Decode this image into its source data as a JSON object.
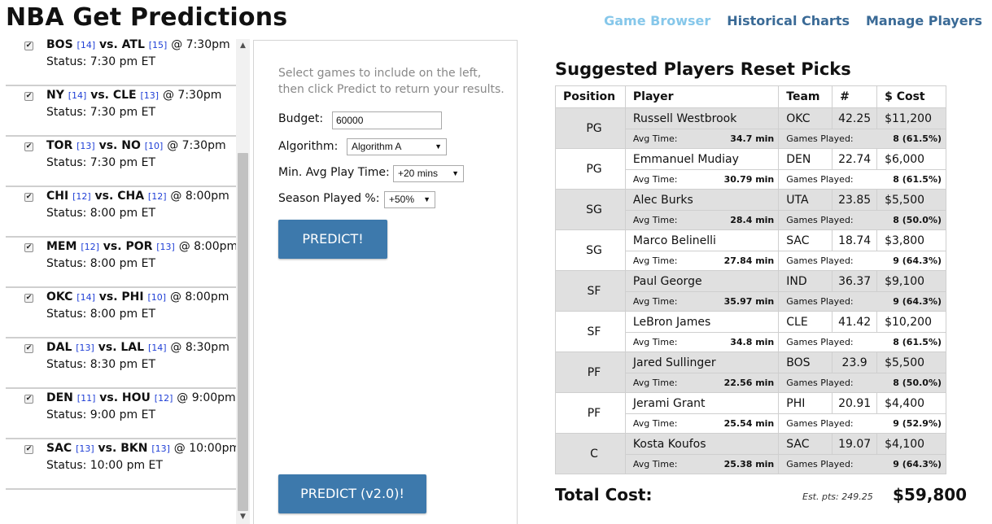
{
  "app": {
    "title": "NBA Get Predictions"
  },
  "nav": {
    "items": [
      "Game Browser",
      "Historical Charts",
      "Manage Players"
    ]
  },
  "games": [
    {
      "home": "BOS",
      "home_rank": "[14]",
      "vs": "vs.",
      "away": "ATL",
      "away_rank": "[15]",
      "time": "@ 7:30pm",
      "status": "Status: 7:30 pm ET",
      "checked": true
    },
    {
      "home": "NY",
      "home_rank": "[14]",
      "vs": "vs.",
      "away": "CLE",
      "away_rank": "[13]",
      "time": "@ 7:30pm",
      "status": "Status: 7:30 pm ET",
      "checked": true
    },
    {
      "home": "TOR",
      "home_rank": "[13]",
      "vs": "vs.",
      "away": "NO",
      "away_rank": "[10]",
      "time": "@ 7:30pm",
      "status": "Status: 7:30 pm ET",
      "checked": true
    },
    {
      "home": "CHI",
      "home_rank": "[12]",
      "vs": "vs.",
      "away": "CHA",
      "away_rank": "[12]",
      "time": "@ 8:00pm",
      "status": "Status: 8:00 pm ET",
      "checked": true
    },
    {
      "home": "MEM",
      "home_rank": "[12]",
      "vs": "vs.",
      "away": "POR",
      "away_rank": "[13]",
      "time": "@ 8:00pm",
      "status": "Status: 8:00 pm ET",
      "checked": true
    },
    {
      "home": "OKC",
      "home_rank": "[14]",
      "vs": "vs.",
      "away": "PHI",
      "away_rank": "[10]",
      "time": "@ 8:00pm",
      "status": "Status: 8:00 pm ET",
      "checked": true
    },
    {
      "home": "DAL",
      "home_rank": "[13]",
      "vs": "vs.",
      "away": "LAL",
      "away_rank": "[14]",
      "time": "@ 8:30pm",
      "status": "Status: 8:30 pm ET",
      "checked": true
    },
    {
      "home": "DEN",
      "home_rank": "[11]",
      "vs": "vs.",
      "away": "HOU",
      "away_rank": "[12]",
      "time": "@ 9:00pm",
      "status": "Status: 9:00 pm ET",
      "checked": true
    },
    {
      "home": "SAC",
      "home_rank": "[13]",
      "vs": "vs.",
      "away": "BKN",
      "away_rank": "[13]",
      "time": "@ 10:00pm",
      "status": "Status: 10:00 pm ET",
      "checked": true
    }
  ],
  "form": {
    "instructions": "Select games to include on the left, then click Predict to return your results.",
    "budget_label": "Budget:",
    "budget_value": "60000",
    "algorithm_label": "Algorithm:",
    "algorithm_value": "Algorithm A",
    "min_play_label": "Min. Avg Play Time:",
    "min_play_value": "+20 mins",
    "season_label": "Season Played %:",
    "season_value": "+50%",
    "predict_label": "PREDICT!",
    "predict_v2_label": "PREDICT (v2.0)!"
  },
  "results": {
    "title": "Suggested Players Reset Picks",
    "headers": [
      "Position",
      "Player",
      "Team",
      "#",
      "$ Cost"
    ],
    "avg_time_label": "Avg Time:",
    "games_played_label": "Games Played:",
    "rows": [
      {
        "pos": "PG",
        "player": "Russell Westbrook",
        "team": "OKC",
        "num": "42.25",
        "cost": "$11,200",
        "avg_time": "34.7 min",
        "games": "8 (61.5%)",
        "shaded": true
      },
      {
        "pos": "PG",
        "player": "Emmanuel Mudiay",
        "team": "DEN",
        "num": "22.74",
        "cost": "$6,000",
        "avg_time": "30.79 min",
        "games": "8 (61.5%)",
        "shaded": false
      },
      {
        "pos": "SG",
        "player": "Alec Burks",
        "team": "UTA",
        "num": "23.85",
        "cost": "$5,500",
        "avg_time": "28.4 min",
        "games": "8 (50.0%)",
        "shaded": true
      },
      {
        "pos": "SG",
        "player": "Marco Belinelli",
        "team": "SAC",
        "num": "18.74",
        "cost": "$3,800",
        "avg_time": "27.84 min",
        "games": "9 (64.3%)",
        "shaded": false
      },
      {
        "pos": "SF",
        "player": "Paul George",
        "team": "IND",
        "num": "36.37",
        "cost": "$9,100",
        "avg_time": "35.97 min",
        "games": "9 (64.3%)",
        "shaded": true
      },
      {
        "pos": "SF",
        "player": "LeBron James",
        "team": "CLE",
        "num": "41.42",
        "cost": "$10,200",
        "avg_time": "34.8 min",
        "games": "8 (61.5%)",
        "shaded": false
      },
      {
        "pos": "PF",
        "player": "Jared Sullinger",
        "team": "BOS",
        "num": "23.9",
        "cost": "$5,500",
        "avg_time": "22.56 min",
        "games": "8 (50.0%)",
        "shaded": true
      },
      {
        "pos": "PF",
        "player": "Jerami Grant",
        "team": "PHI",
        "num": "20.91",
        "cost": "$4,400",
        "avg_time": "25.54 min",
        "games": "9 (52.9%)",
        "shaded": false
      },
      {
        "pos": "C",
        "player": "Kosta Koufos",
        "team": "SAC",
        "num": "19.07",
        "cost": "$4,100",
        "avg_time": "25.38 min",
        "games": "9 (64.3%)",
        "shaded": true
      }
    ],
    "total_label": "Total Cost:",
    "est_pts": "Est. pts: 249.25",
    "total_value": "$59,800"
  }
}
